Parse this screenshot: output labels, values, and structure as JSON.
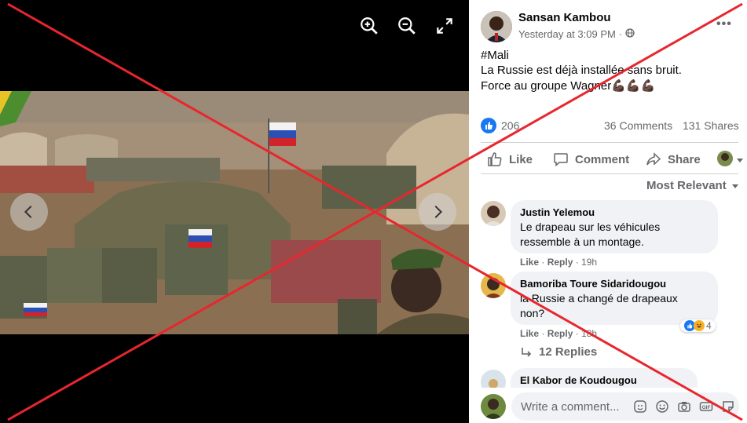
{
  "post": {
    "author": "Sansan Kambou",
    "timestamp": "Yesterday at 3:09 PM",
    "visibility_icon": "globe-icon",
    "text": {
      "hashtag": "#Mali",
      "line1": "La Russie est déjà installée sans bruit.",
      "line2": "Force au groupe Wagner",
      "line2_emoji": "💪🏿💪🏿💪🏿"
    },
    "reaction_count": "206",
    "comments_count": "36 Comments",
    "shares_count": "131 Shares",
    "actions": {
      "like": "Like",
      "comment": "Comment",
      "share": "Share"
    },
    "sort_label": "Most Relevant"
  },
  "comments": [
    {
      "name": "Justin Yelemou",
      "line1": "Le drapeau sur les véhicules",
      "line2": "ressemble à un montage.",
      "like": "Like",
      "reply": "Reply",
      "age": "19h"
    },
    {
      "name": "Bamoriba Toure Sidaridougou",
      "line1": "la Russie a changé de drapeaux",
      "line2": "non?",
      "like": "Like",
      "reply": "Reply",
      "age": "18h",
      "reaction_count": "4"
    },
    {
      "name": "El Kabor de Koudougou"
    }
  ],
  "replies_label": "12 Replies",
  "write_comment_placeholder": "Write a comment...",
  "colors": {
    "facebook_blue": "#1877f2",
    "cross_red": "#e8262d",
    "text_secondary": "#65676b"
  }
}
